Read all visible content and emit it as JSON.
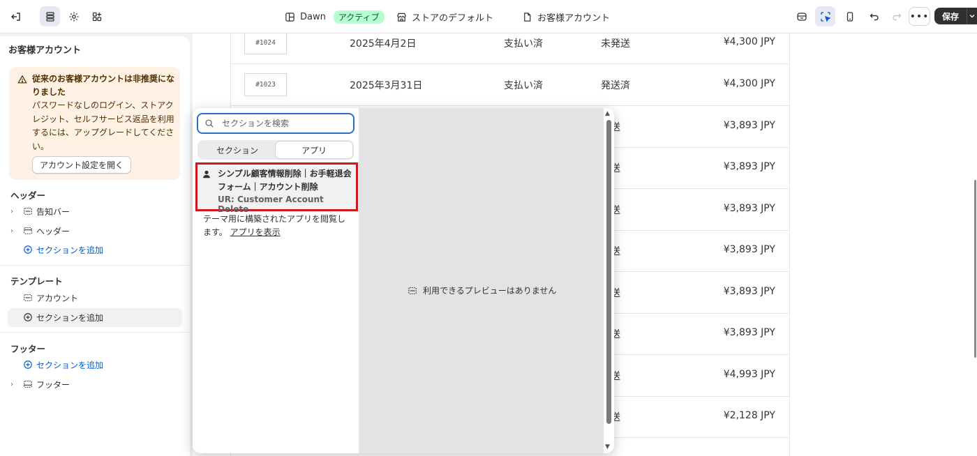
{
  "topbar": {
    "theme_name": "Dawn",
    "theme_status": "アクティブ",
    "store_default": "ストアのデフォルト",
    "page": "お客様アカウント",
    "save_label": "保存"
  },
  "sidebar": {
    "title": "お客様アカウント",
    "warning": {
      "title": "従来のお客様アカウントは非推奨になりました",
      "body": "パスワードなしのログイン、ストアクレジット、セルフサービス返品を利用するには、アップグレードしてください。",
      "button": "アカウント設定を開く"
    },
    "header_heading": "ヘッダー",
    "header_items": [
      "告知バー",
      "ヘッダー"
    ],
    "template_heading": "テンプレート",
    "template_items": [
      "アカウント"
    ],
    "footer_heading": "フッター",
    "footer_items": [
      "フッター"
    ],
    "add_section": "セクションを追加"
  },
  "orders": [
    {
      "number": "#1024",
      "date": "2025年4月2日",
      "payment": "支払い済",
      "fulfillment": "未発送",
      "total": "¥4,300 JPY"
    },
    {
      "number": "#1023",
      "date": "2025年3月31日",
      "payment": "支払い済",
      "fulfillment": "発送済",
      "total": "¥4,300 JPY"
    },
    {
      "number": "",
      "date": "",
      "payment": "",
      "fulfillment": "発送",
      "total": "¥3,893 JPY"
    },
    {
      "number": "",
      "date": "",
      "payment": "",
      "fulfillment": "発送",
      "total": "¥3,893 JPY"
    },
    {
      "number": "",
      "date": "",
      "payment": "",
      "fulfillment": "発送",
      "total": "¥3,893 JPY"
    },
    {
      "number": "",
      "date": "",
      "payment": "",
      "fulfillment": "発送",
      "total": "¥3,893 JPY"
    },
    {
      "number": "",
      "date": "",
      "payment": "",
      "fulfillment": "発送",
      "total": "¥3,893 JPY"
    },
    {
      "number": "",
      "date": "",
      "payment": "",
      "fulfillment": "発送",
      "total": "¥3,893 JPY"
    },
    {
      "number": "",
      "date": "",
      "payment": "",
      "fulfillment": "発送",
      "total": "¥4,993 JPY"
    },
    {
      "number": "",
      "date": "",
      "payment": "",
      "fulfillment": "発送",
      "total": "¥2,128 JPY"
    }
  ],
  "popover": {
    "search_placeholder": "セクションを検索",
    "tab_sections": "セクション",
    "tab_apps": "アプリ",
    "app_name": "シンプル顧客情報削除｜お手軽退会フォーム｜アカウント削除",
    "app_block": "UR: Customer Account Delete",
    "info_text": "テーマ用に構築されたアプリを閲覧します。",
    "info_link": "アプリを表示",
    "no_preview": "利用できるプレビューはありません"
  },
  "colors": {
    "accent": "#005bd3",
    "warning_bg": "#fff1e3",
    "badge_bg": "#b4fed2",
    "highlight_border": "#d0161e"
  }
}
